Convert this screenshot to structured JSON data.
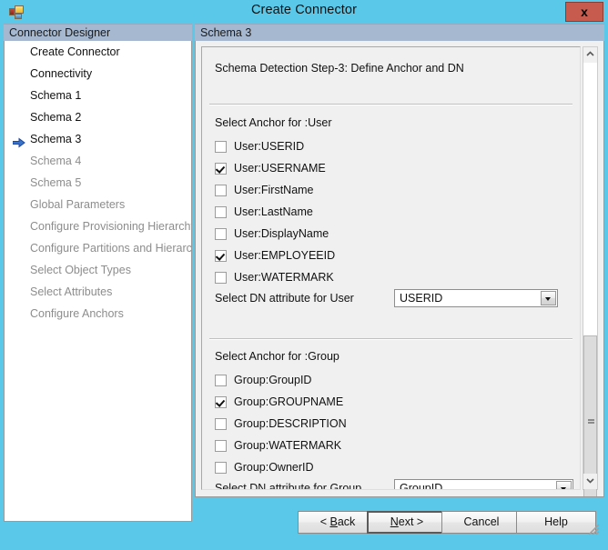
{
  "window": {
    "title": "Create Connector",
    "close_label": "x",
    "icon": "connector-app-icon"
  },
  "sidebar": {
    "header": "Connector Designer",
    "items": [
      {
        "label": "Create Connector",
        "state": "visited",
        "current": false
      },
      {
        "label": "Connectivity",
        "state": "visited",
        "current": false
      },
      {
        "label": "Schema 1",
        "state": "visited",
        "current": false
      },
      {
        "label": "Schema 2",
        "state": "visited",
        "current": false
      },
      {
        "label": "Schema 3",
        "state": "current",
        "current": true
      },
      {
        "label": "Schema 4",
        "state": "disabled",
        "current": false
      },
      {
        "label": "Schema 5",
        "state": "disabled",
        "current": false
      },
      {
        "label": "Global Parameters",
        "state": "disabled",
        "current": false
      },
      {
        "label": "Configure Provisioning Hierarchy",
        "state": "disabled",
        "current": false
      },
      {
        "label": "Configure Partitions and Hierarchies",
        "state": "disabled",
        "current": false
      },
      {
        "label": "Select Object Types",
        "state": "disabled",
        "current": false
      },
      {
        "label": "Select Attributes",
        "state": "disabled",
        "current": false
      },
      {
        "label": "Configure Anchors",
        "state": "disabled",
        "current": false
      }
    ]
  },
  "main": {
    "header": "Schema 3",
    "step_title": "Schema Detection Step-3: Define Anchor and DN",
    "user_section": {
      "label": "Select Anchor for :User",
      "checkboxes": [
        {
          "label": "User:USERID",
          "checked": false
        },
        {
          "label": "User:USERNAME",
          "checked": true
        },
        {
          "label": "User:FirstName",
          "checked": false
        },
        {
          "label": "User:LastName",
          "checked": false
        },
        {
          "label": "User:DisplayName",
          "checked": false
        },
        {
          "label": "User:EMPLOYEEID",
          "checked": true
        },
        {
          "label": "User:WATERMARK",
          "checked": false
        }
      ],
      "dn_label": "Select DN attribute for User",
      "dn_value": "USERID"
    },
    "group_section": {
      "label": "Select Anchor for :Group",
      "checkboxes": [
        {
          "label": "Group:GroupID",
          "checked": false
        },
        {
          "label": "Group:GROUPNAME",
          "checked": true
        },
        {
          "label": "Group:DESCRIPTION",
          "checked": false
        },
        {
          "label": "Group:WATERMARK",
          "checked": false
        },
        {
          "label": "Group:OwnerID",
          "checked": false
        }
      ],
      "dn_label": "Select DN attribute for Group",
      "dn_value": "GroupID"
    }
  },
  "scrollbar": {
    "up_icon": "chevron-up-icon",
    "down_icon": "chevron-down-icon"
  },
  "footer": {
    "back": "< Back",
    "back_prefix": "< ",
    "back_accel": "B",
    "back_rest": "ack",
    "next_prefix": "",
    "next_accel": "N",
    "next_rest": "ext  >",
    "cancel": "Cancel",
    "help": "Help"
  },
  "colors": {
    "window_frame": "#5ac8e8",
    "panel_header": "#a6b8cf",
    "close_button": "#c75b4e",
    "nav_arrow": "#2a5fb4"
  }
}
